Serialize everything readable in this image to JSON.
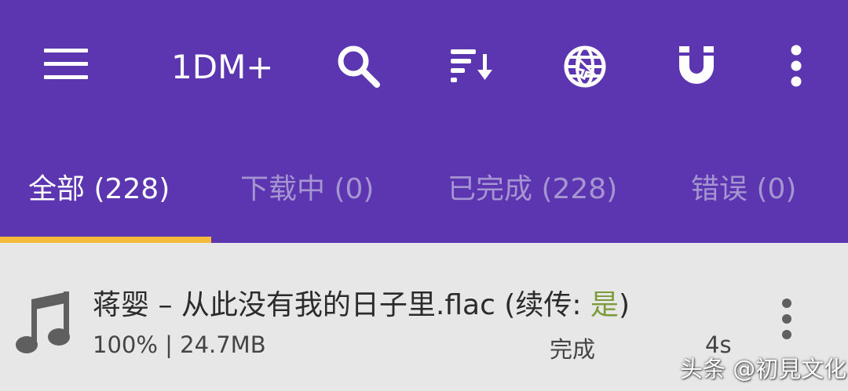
{
  "colors": {
    "appbar": "#5b36b0",
    "tab_indicator": "#f5b93b",
    "list_background": "#e7e7e7",
    "resume_highlight": "#7c9c3a"
  },
  "toolbar": {
    "title": "1DM+",
    "icons": [
      "menu-icon",
      "search-icon",
      "sort-icon",
      "browser-globe-icon",
      "magnet-icon",
      "more-vert-icon"
    ]
  },
  "tabs": [
    {
      "label": "全部 (228)",
      "active": true
    },
    {
      "label": "下载中 (0)",
      "active": false
    },
    {
      "label": "已完成 (228)",
      "active": false
    },
    {
      "label": "错误 (0)",
      "active": false
    }
  ],
  "downloads": [
    {
      "icon": "music-note-icon",
      "title_prefix": "蒋婴 – 从此没有我的日子里.flac (续传: ",
      "resume_value": "是",
      "title_suffix": ")",
      "progress_size": "100% | 24.7MB",
      "status": "完成",
      "time": "4s"
    }
  ],
  "watermark": "头条 @初見文化"
}
